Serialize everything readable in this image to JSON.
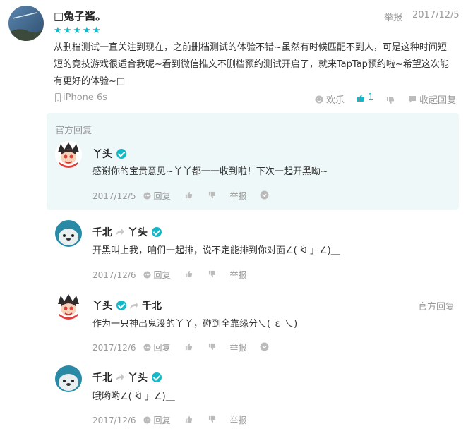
{
  "review": {
    "username": "□兔子酱。",
    "stars": 5,
    "report_label": "举报",
    "date": "2017/12/5",
    "content": "从删档测试一直关注到现在，之前删档测试的体验不错~虽然有时候匹配不到人，可是这种时间短短的竞技游戏很适合我呢~看到微信推文不删档预约测试开启了，就来TapTap预约啦~希望这次能有更好的体验~□",
    "device": "iPhone 6s",
    "mood_label": "欢乐",
    "like_count": "1",
    "collapse_label": "收起回复"
  },
  "official_section": {
    "title": "官方回复"
  },
  "replies": [
    {
      "author": "丫头",
      "verified": true,
      "reply_to": "",
      "content": "感谢你的宝贵意见~丫丫都一一收到啦！下次一起开黑呦~",
      "date": "2017/12/5",
      "reply_label": "回复",
      "report_label": "举报",
      "tag": ""
    },
    {
      "author": "千北",
      "verified": false,
      "reply_to": "丫头",
      "reply_to_verified": true,
      "content": "开黑叫上我，咱们一起排，说不定能排到你对面∠( ᐛ 」∠)＿",
      "date": "2017/12/6",
      "reply_label": "回复",
      "report_label": "举报",
      "tag": ""
    },
    {
      "author": "丫头",
      "verified": true,
      "reply_to": "千北",
      "reply_to_verified": false,
      "content": "作为一只神出鬼没的丫丫，碰到全靠缘分乀(ˉεˉ乀)",
      "date": "2017/12/6",
      "reply_label": "回复",
      "report_label": "举报",
      "tag": "官方回复"
    },
    {
      "author": "千北",
      "verified": false,
      "reply_to": "丫头",
      "reply_to_verified": true,
      "content": "哦哟哟∠( ᐛ 」∠)＿",
      "date": "2017/12/6",
      "reply_label": "回复",
      "report_label": "举报",
      "tag": ""
    }
  ],
  "colors": {
    "accent": "#14b9c8",
    "official_bg": "#eef8f9",
    "muted": "#9a9a9a"
  }
}
